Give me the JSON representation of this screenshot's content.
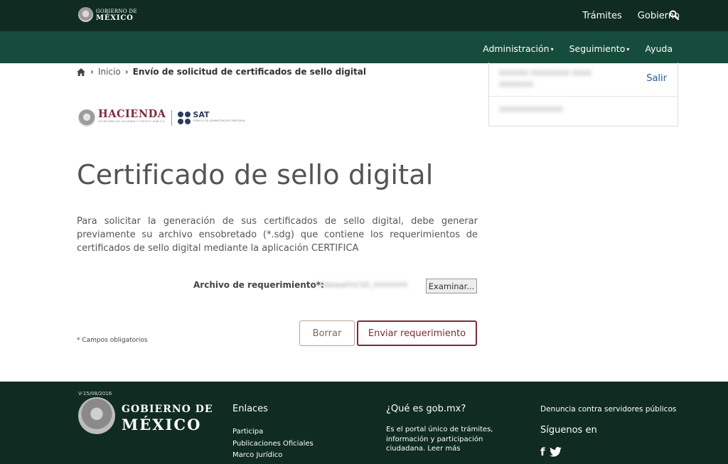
{
  "header": {
    "logo_line1": "GOBIERNO DE",
    "logo_line2": "MÉXICO",
    "nav": [
      "Trámites",
      "Gobierno"
    ],
    "search_icon": "search-icon"
  },
  "subnav": {
    "items": [
      {
        "label": "Administración",
        "caret": "▾"
      },
      {
        "label": "Seguimiento",
        "caret": "▾"
      },
      {
        "label": "Ayuda",
        "caret": ""
      }
    ]
  },
  "breadcrumb": {
    "home_icon": "home-icon",
    "sep": "›",
    "link": "Inicio",
    "current": "Envío de solicitud de certificados de sello digital"
  },
  "user_panel": {
    "name": "XXXXXX XXXXXXXX XXXX XXXXXXX",
    "logout": "Salir",
    "rfc": "XXXXXXXXXXXXX"
  },
  "brand": {
    "hacienda": "HACIENDA",
    "hacienda_sub": "SECRETARÍA DE HACIENDA Y CRÉDITO PÚBLICO",
    "sat": "SAT",
    "sat_sub": "SERVICIO DE ADMINISTRACIÓN TRIBUTARIA"
  },
  "main": {
    "title": "Certificado de sello digital",
    "description": "Para solicitar la generación de sus certificados de sello digital, debe generar previamente su archivo ensobretado (*.sdg) que contiene los requerimientos de certificados de sello digital mediante la aplicación CERTIFICA"
  },
  "form": {
    "file_label": "Archivo de requerimiento*:",
    "file_value": "C:\\fakepath\\CSD_XXXXXXX",
    "browse_label": "Examinar...",
    "required_note": "* Campos obligatorios",
    "clear_label": "Borrar",
    "submit_label": "Enviar requerimiento"
  },
  "footer": {
    "version": "V-15/08/2016",
    "logo_line1": "GOBIERNO DE",
    "logo_line2": "MÉXICO",
    "links_title": "Enlaces",
    "links": [
      "Participa",
      "Publicaciones Oficiales",
      "Marco Jurídico"
    ],
    "about_title": "¿Qué es gob.mx?",
    "about_text": "Es el portal único de trámites, información y participación ciudadana. Leer más",
    "report": "Denuncia contra servidores públicos",
    "follow": "Síguenos en",
    "facebook_glyph": "f",
    "social_icons": [
      "facebook-icon",
      "twitter-icon"
    ]
  },
  "colors": {
    "header_dark": "#0f2b22",
    "header_green": "#164c3b",
    "accent": "#7b2a3a"
  }
}
